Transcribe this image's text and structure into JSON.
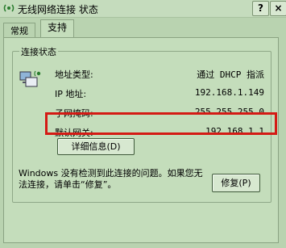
{
  "window": {
    "title": "无线网络连接 状态",
    "help_label": "?",
    "close_label": "×"
  },
  "tabs": [
    "常规",
    "支持"
  ],
  "connection_status": {
    "group_label": "连接状态",
    "rows": [
      {
        "label": "地址类型:",
        "value": "通过 DHCP 指派"
      },
      {
        "label": "IP 地址:",
        "value": "192.168.1.149"
      },
      {
        "label": "子网掩码:",
        "value": "255.255.255.0"
      },
      {
        "label": "默认网关:",
        "value": "192.168.1.1"
      }
    ],
    "details_button": "详细信息(D)"
  },
  "message": "Windows 没有检测到此连接的问题。如果您无法连接，请单击“修复”。",
  "repair_button": "修复(P)",
  "colors": {
    "highlight": "#d41a14"
  }
}
